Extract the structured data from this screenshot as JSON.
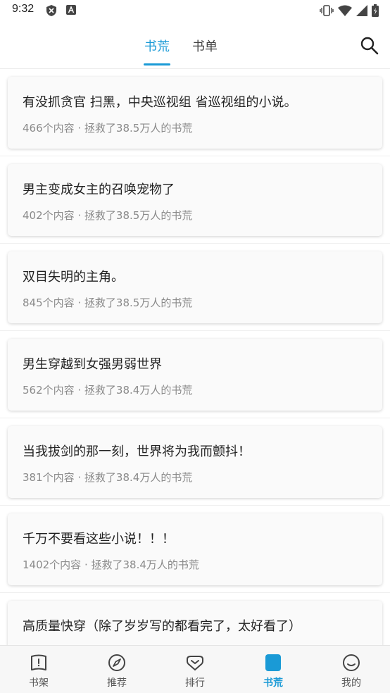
{
  "status_bar": {
    "time": "9:32"
  },
  "tabs": [
    {
      "label": "书荒"
    },
    {
      "label": "书单"
    }
  ],
  "accent_color": "#1a9ad6",
  "cards": [
    {
      "title": "有没抓贪官 扫黑，中央巡视组 省巡视组的小说。",
      "meta": "466个内容 · 拯救了38.5万人的书荒"
    },
    {
      "title": "男主变成女主的召唤宠物了",
      "meta": "402个内容 · 拯救了38.5万人的书荒"
    },
    {
      "title": "双目失明的主角。",
      "meta": "845个内容 · 拯救了38.5万人的书荒"
    },
    {
      "title": "男生穿越到女强男弱世界",
      "meta": "562个内容 · 拯救了38.4万人的书荒"
    },
    {
      "title": "当我拔剑的那一刻，世界将为我而颤抖！",
      "meta": "381个内容 · 拯救了38.4万人的书荒"
    },
    {
      "title": "千万不要看这些小说！！！",
      "meta": "1402个内容 · 拯救了38.4万人的书荒"
    },
    {
      "title": "高质量快穿（除了岁岁写的都看完了，太好看了）",
      "meta": ""
    }
  ],
  "bottom_nav": [
    {
      "label": "书架",
      "icon": "bookshelf-icon"
    },
    {
      "label": "推荐",
      "icon": "compass-icon"
    },
    {
      "label": "排行",
      "icon": "ranking-icon"
    },
    {
      "label": "书荒",
      "icon": "book-shortage-icon"
    },
    {
      "label": "我的",
      "icon": "smile-icon"
    }
  ]
}
